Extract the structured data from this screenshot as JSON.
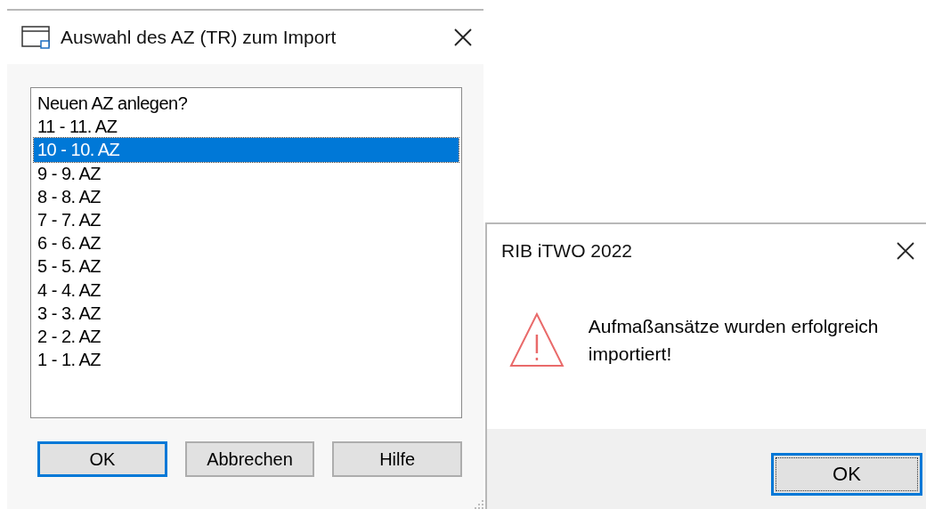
{
  "import_dialog": {
    "title": "Auswahl des AZ (TR) zum Import",
    "items": [
      {
        "label": "Neuen AZ anlegen?",
        "selected": false
      },
      {
        "label": "11 - 11. AZ",
        "selected": false
      },
      {
        "label": "10 - 10. AZ",
        "selected": true
      },
      {
        "label": "9 - 9. AZ",
        "selected": false
      },
      {
        "label": "8 - 8. AZ",
        "selected": false
      },
      {
        "label": "7 - 7. AZ",
        "selected": false
      },
      {
        "label": "6 - 6. AZ",
        "selected": false
      },
      {
        "label": "5 - 5. AZ",
        "selected": false
      },
      {
        "label": "4 - 4. AZ",
        "selected": false
      },
      {
        "label": "3 - 3. AZ",
        "selected": false
      },
      {
        "label": "2 - 2. AZ",
        "selected": false
      },
      {
        "label": "1 - 1. AZ",
        "selected": false
      }
    ],
    "buttons": [
      {
        "label": "OK",
        "default": true
      },
      {
        "label": "Abbrechen",
        "default": false
      },
      {
        "label": "Hilfe",
        "default": false
      }
    ]
  },
  "message_box": {
    "title": "RIB iTWO 2022",
    "message": "Aufmaßansätze wurden erfolgreich importiert!",
    "buttons": [
      {
        "label": "OK",
        "default": true
      }
    ]
  }
}
